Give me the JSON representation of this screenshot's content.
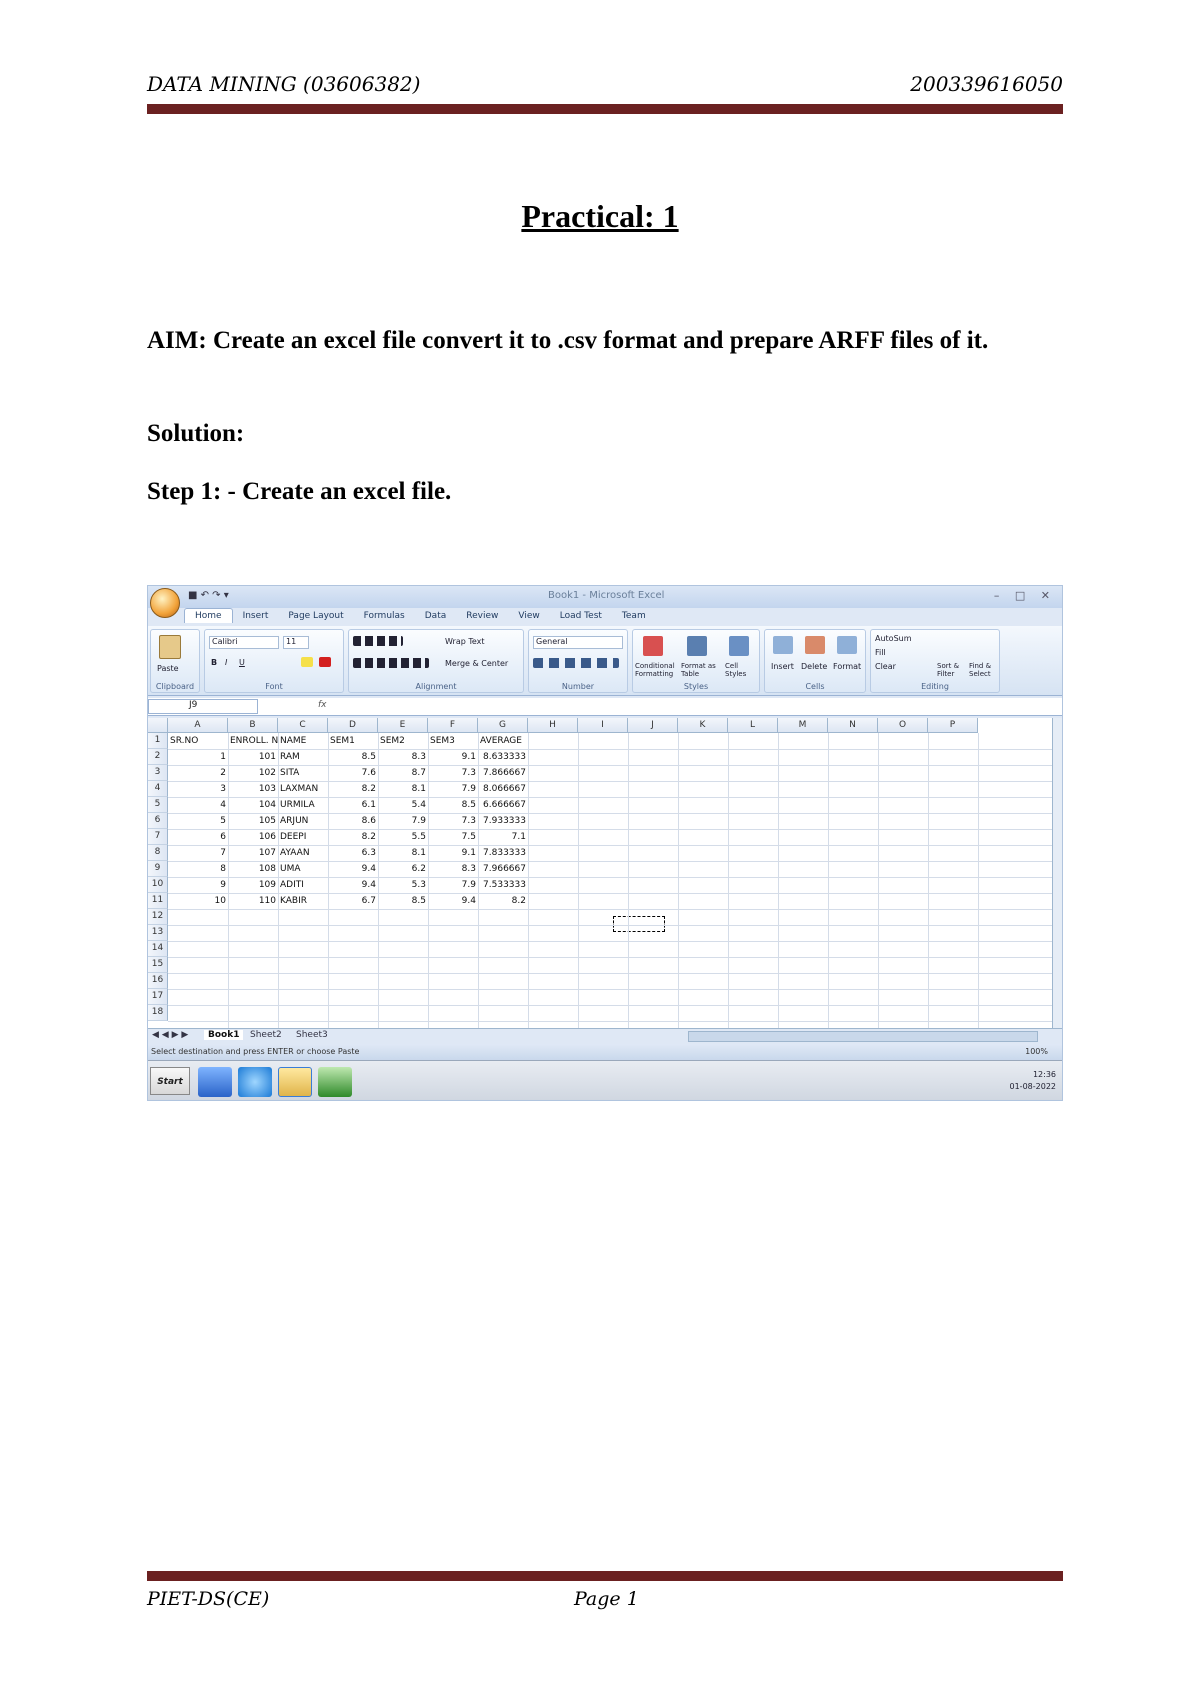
{
  "header": {
    "left": "DATA MINING (03606382)",
    "right": "200339616050"
  },
  "title": "Practical: 1",
  "aim": "AIM: Create an excel file convert it to .csv format and prepare ARFF files of it.",
  "solution": "Solution:",
  "step1": "Step 1: - Create an excel file.",
  "footer": {
    "left": "PIET-DS(CE)",
    "page": "Page 1"
  },
  "excel": {
    "window_title": "Book1 - Microsoft Excel",
    "qat": "■ ↶ ↷ ▾",
    "win_controls": "– □ ✕",
    "tabs": [
      "Home",
      "Insert",
      "Page Layout",
      "Formulas",
      "Data",
      "Review",
      "View",
      "Load Test",
      "Team"
    ],
    "font_name": "Calibri",
    "font_size": "11",
    "number_format": "General",
    "wrap_text": "Wrap Text",
    "merge_center": "Merge & Center",
    "group_labels": [
      "Clipboard",
      "Font",
      "Alignment",
      "Number",
      "Styles",
      "Cells",
      "Editing"
    ],
    "style_buttons": [
      "Conditional Formatting",
      "Format as Table",
      "Cell Styles"
    ],
    "cell_buttons": [
      "Insert",
      "Delete",
      "Format"
    ],
    "editing_buttons": [
      "AutoSum",
      "Fill",
      "Clear",
      "Sort & Filter",
      "Find & Select"
    ],
    "paste_label": "Paste",
    "name_box": "J9",
    "fx": "fx",
    "columns": [
      "A",
      "B",
      "C",
      "D",
      "E",
      "F",
      "G",
      "H",
      "I",
      "J",
      "K",
      "L",
      "M",
      "N",
      "O",
      "P"
    ],
    "row_numbers": [
      "1",
      "2",
      "3",
      "4",
      "5",
      "6",
      "7",
      "8",
      "9",
      "10",
      "11",
      "12",
      "13",
      "14",
      "15",
      "16",
      "17",
      "18"
    ],
    "table": {
      "headers": [
        "SR.NO",
        "ENROLL. NO.",
        "NAME",
        "SEM1",
        "SEM2",
        "SEM3",
        "AVERAGE"
      ],
      "rows": [
        [
          "1",
          "101",
          "RAM",
          "8.5",
          "8.3",
          "9.1",
          "8.633333"
        ],
        [
          "2",
          "102",
          "SITA",
          "7.6",
          "8.7",
          "7.3",
          "7.866667"
        ],
        [
          "3",
          "103",
          "LAXMAN",
          "8.2",
          "8.1",
          "7.9",
          "8.066667"
        ],
        [
          "4",
          "104",
          "URMILA",
          "6.1",
          "5.4",
          "8.5",
          "6.666667"
        ],
        [
          "5",
          "105",
          "ARJUN",
          "8.6",
          "7.9",
          "7.3",
          "7.933333"
        ],
        [
          "6",
          "106",
          "DEEPI",
          "8.2",
          "5.5",
          "7.5",
          "7.1"
        ],
        [
          "7",
          "107",
          "AYAAN",
          "6.3",
          "8.1",
          "9.1",
          "7.833333"
        ],
        [
          "8",
          "108",
          "UMA",
          "9.4",
          "6.2",
          "8.3",
          "7.966667"
        ],
        [
          "9",
          "109",
          "ADITI",
          "9.4",
          "5.3",
          "7.9",
          "7.533333"
        ],
        [
          "10",
          "110",
          "KABIR",
          "6.7",
          "8.5",
          "9.4",
          "8.2"
        ]
      ]
    },
    "sheet_tabs": [
      "Book1",
      "Sheet2",
      "Sheet3"
    ],
    "status": "Select destination and press ENTER or choose Paste",
    "zoom": "100%",
    "taskbar_start": "Start",
    "tray_time": "12:36",
    "tray_date": "01-08-2022"
  }
}
